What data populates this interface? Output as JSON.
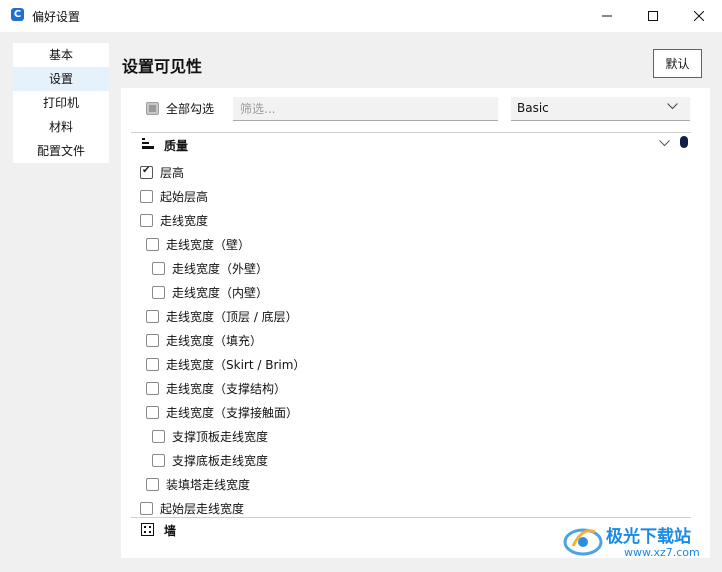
{
  "window": {
    "title": "偏好设置",
    "app_icon_letter": "C",
    "accent_color": "#1f6fd1"
  },
  "sidebar": {
    "items": [
      {
        "label": "基本"
      },
      {
        "label": "设置"
      },
      {
        "label": "打印机"
      },
      {
        "label": "材料"
      },
      {
        "label": "配置文件"
      }
    ],
    "active": "设置"
  },
  "main": {
    "title": "设置可见性",
    "default_button": "默认",
    "check_all_label": "全部勾选",
    "filter_placeholder": "筛选...",
    "profile_select_value": "Basic"
  },
  "sections": {
    "quality": {
      "title": "质量",
      "icon": "quality-bars-icon",
      "settings": [
        {
          "label": "层高",
          "checked": true
        },
        {
          "label": "起始层高",
          "checked": false
        },
        {
          "label": "走线宽度",
          "checked": false
        },
        {
          "label": "走线宽度（壁）",
          "checked": false
        },
        {
          "label": "走线宽度（外壁）",
          "checked": false
        },
        {
          "label": "走线宽度（内壁）",
          "checked": false
        },
        {
          "label": "走线宽度（顶层 / 底层）",
          "checked": false
        },
        {
          "label": "走线宽度（填充）",
          "checked": false
        },
        {
          "label": "走线宽度（Skirt / Brim）",
          "checked": false
        },
        {
          "label": "走线宽度（支撑结构）",
          "checked": false
        },
        {
          "label": "走线宽度（支撑接触面）",
          "checked": false
        },
        {
          "label": "支撑顶板走线宽度",
          "checked": false
        },
        {
          "label": "支撑底板走线宽度",
          "checked": false
        },
        {
          "label": "装填塔走线宽度",
          "checked": false
        },
        {
          "label": "起始层走线宽度",
          "checked": false
        }
      ]
    },
    "wall": {
      "title": "墙",
      "icon": "wall-grid-icon"
    }
  },
  "watermark": {
    "name": "极光下载站",
    "url": "www.xz7.com"
  }
}
